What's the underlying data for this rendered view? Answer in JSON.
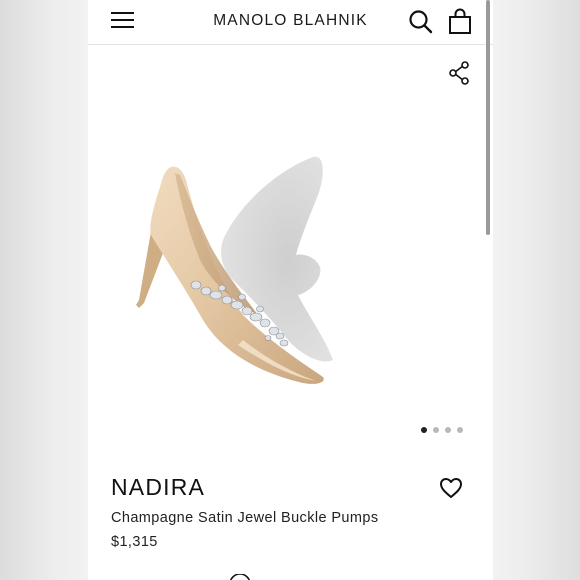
{
  "header": {
    "brand": "MANOLO BLAHNIK",
    "menu_icon": "hamburger-menu-icon",
    "search_icon": "search-icon",
    "bag_icon": "shopping-bag-icon"
  },
  "gallery": {
    "share_icon": "share-icon",
    "image": "champagne satin pump with jewel buckle",
    "slide_count": 4,
    "active_slide": 1
  },
  "product": {
    "name": "NADIRA",
    "description": "Champagne Satin Jewel Buckle Pumps",
    "price": "$1,315",
    "wishlist_icon": "heart-icon"
  },
  "colors": {
    "background": "#ffffff",
    "text": "#111111",
    "dot_active": "#222222",
    "dot_inactive": "#b8b8b8"
  }
}
